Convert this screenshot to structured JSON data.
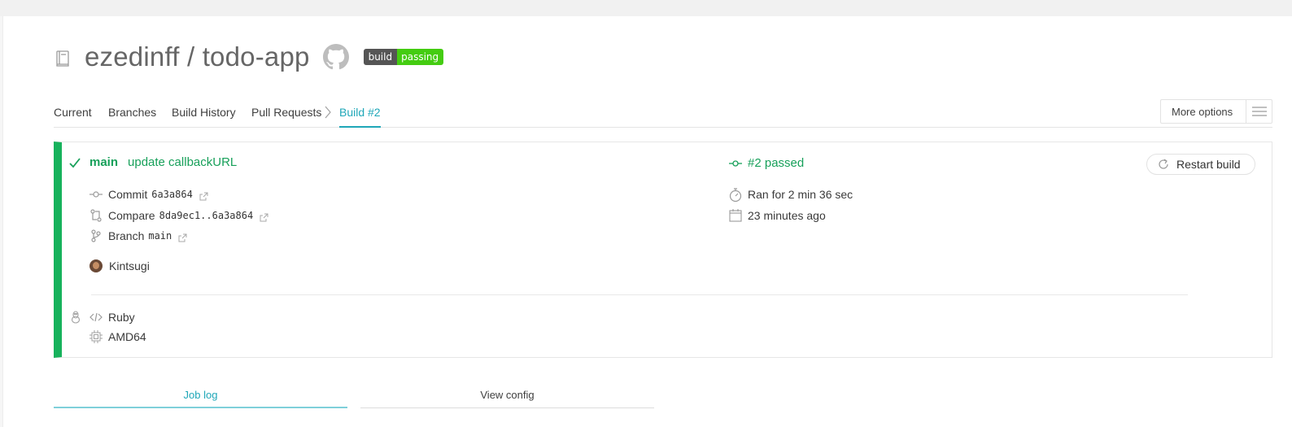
{
  "repo": {
    "title": "ezedinff / todo-app",
    "badge_left": "build",
    "badge_right": "passing"
  },
  "tabs": {
    "current": "Current",
    "branches": "Branches",
    "build_history": "Build History",
    "pull_requests": "Pull Requests",
    "build": "Build #2",
    "more_options": "More options"
  },
  "build": {
    "branch": "main",
    "message": "update callbackURL",
    "state": "#2 passed",
    "restart_label": "Restart build",
    "commit_label": "Commit",
    "commit_sha": "6a3a864",
    "compare_label": "Compare",
    "compare_range": "8da9ec1..6a3a864",
    "branch_label": "Branch",
    "branch_value": "main",
    "author": "Kintsugi",
    "duration": "Ran for 2 min 36 sec",
    "finished": "23 minutes ago",
    "language": "Ruby",
    "arch": "AMD64",
    "status_color": "#17b25c"
  },
  "subtabs": {
    "job_log": "Job log",
    "view_config": "View config"
  }
}
